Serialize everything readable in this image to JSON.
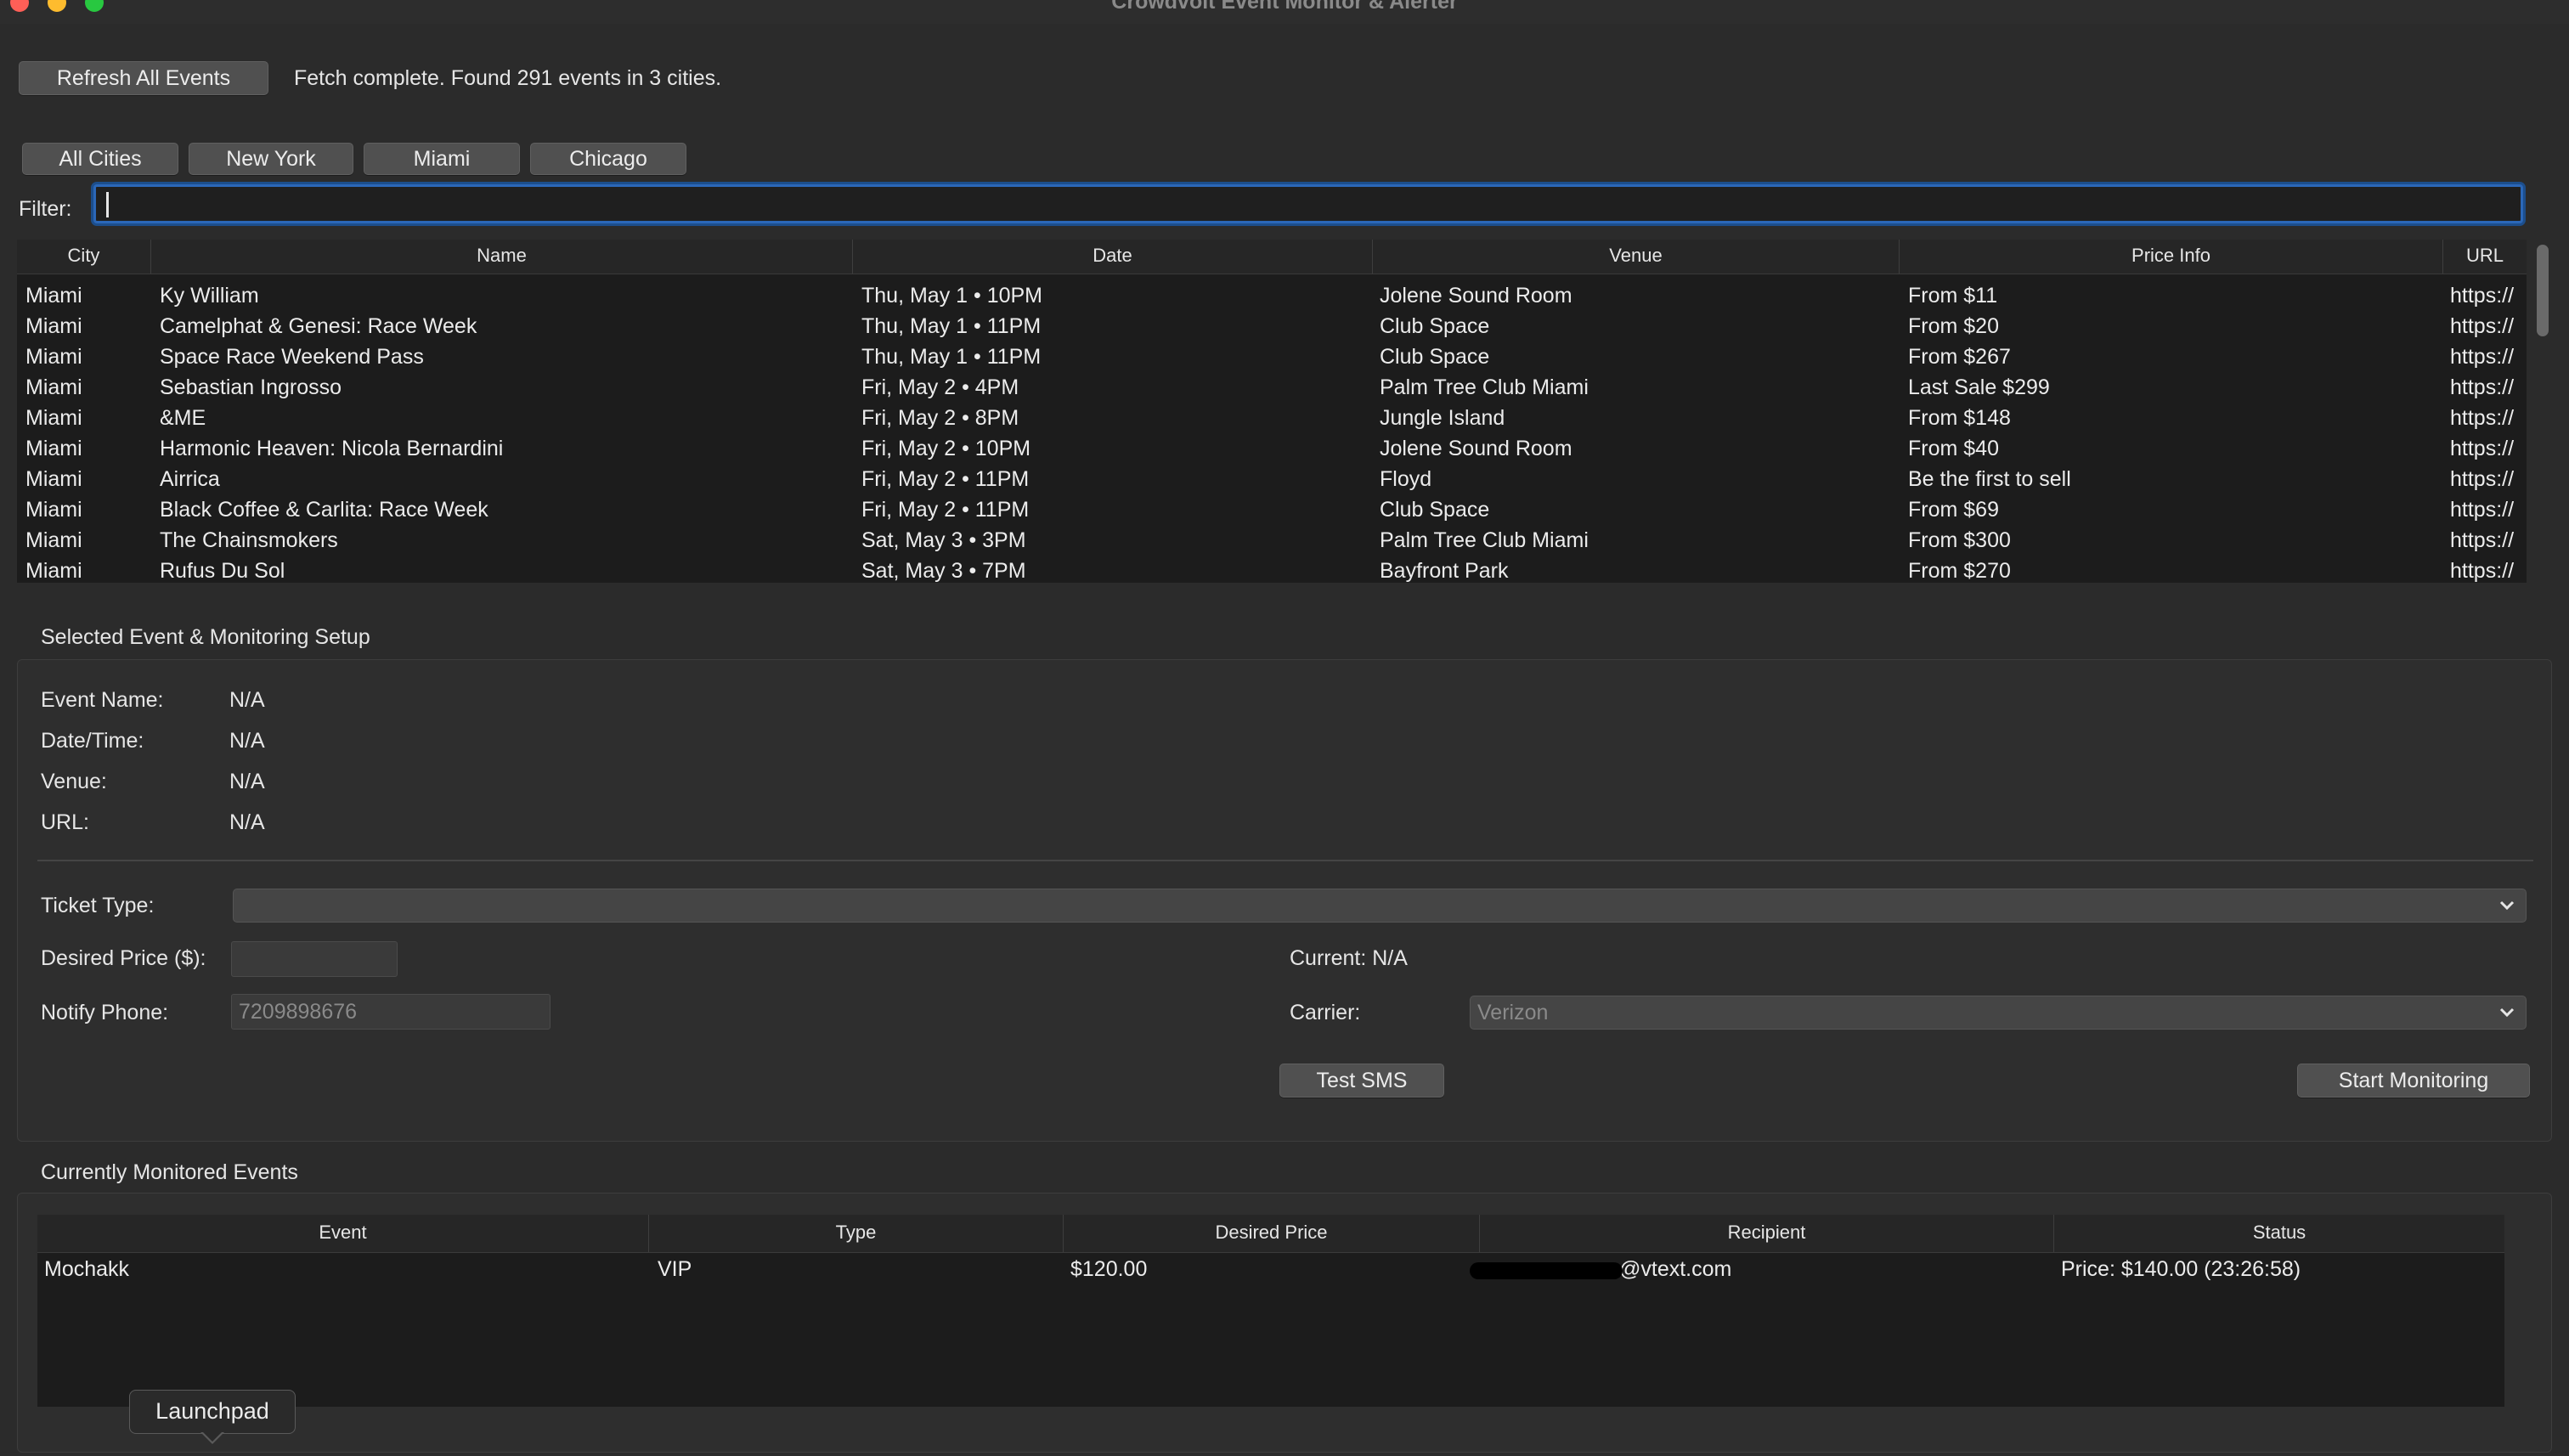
{
  "window": {
    "title": "Crowdvolt Event Monitor & Alerter"
  },
  "toolbar": {
    "refresh_label": "Refresh All Events",
    "status_text": "Fetch complete. Found 291 events in 3 cities."
  },
  "city_tabs": [
    "All Cities",
    "New York",
    "Miami",
    "Chicago"
  ],
  "filter": {
    "label": "Filter:",
    "value": ""
  },
  "events_table": {
    "columns": [
      "City",
      "Name",
      "Date",
      "Venue",
      "Price Info",
      "URL"
    ],
    "rows": [
      [
        "Miami",
        "Ky William",
        "Thu, May 1 • 10PM",
        "Jolene Sound Room",
        "From $11",
        "https://"
      ],
      [
        "Miami",
        "Camelphat & Genesi: Race Week",
        "Thu, May 1 • 11PM",
        "Club Space",
        "From $20",
        "https://"
      ],
      [
        "Miami",
        "Space Race Weekend Pass",
        "Thu, May 1 • 11PM",
        "Club Space",
        "From $267",
        "https://"
      ],
      [
        "Miami",
        "Sebastian Ingrosso",
        "Fri, May 2 • 4PM",
        "Palm Tree Club Miami",
        "Last Sale $299",
        "https://"
      ],
      [
        "Miami",
        "&ME",
        "Fri, May 2 • 8PM",
        "Jungle Island",
        "From $148",
        "https://"
      ],
      [
        "Miami",
        "Harmonic Heaven: Nicola Bernardini",
        "Fri, May 2 • 10PM",
        "Jolene Sound Room",
        "From $40",
        "https://"
      ],
      [
        "Miami",
        "Airrica",
        "Fri, May 2 • 11PM",
        "Floyd",
        "Be the first to sell",
        "https://"
      ],
      [
        "Miami",
        "Black Coffee & Carlita: Race Week",
        "Fri, May 2 • 11PM",
        "Club Space",
        "From $69",
        "https://"
      ],
      [
        "Miami",
        "The Chainsmokers",
        "Sat, May 3 • 3PM",
        "Palm Tree Club Miami",
        "From $300",
        "https://"
      ],
      [
        "Miami",
        "Rufus Du Sol",
        "Sat, May 3 • 7PM",
        "Bayfront Park",
        "From $270",
        "https://"
      ]
    ]
  },
  "selected_event": {
    "section_title": "Selected Event & Monitoring Setup",
    "event_name_label": "Event Name:",
    "event_name_value": "N/A",
    "datetime_label": "Date/Time:",
    "datetime_value": "N/A",
    "venue_label": "Venue:",
    "venue_value": "N/A",
    "url_label": "URL:",
    "url_value": "N/A",
    "ticket_type_label": "Ticket Type:",
    "ticket_type_value": "",
    "desired_price_label": "Desired Price ($):",
    "desired_price_value": "",
    "current_label": "Current: N/A",
    "notify_phone_label": "Notify Phone:",
    "notify_phone_placeholder": "7209898676",
    "carrier_label": "Carrier:",
    "carrier_value": "Verizon",
    "test_sms_label": "Test SMS",
    "start_monitoring_label": "Start Monitoring"
  },
  "monitored": {
    "section_title": "Currently Monitored Events",
    "columns": [
      "Event",
      "Type",
      "Desired Price",
      "Recipient",
      "Status"
    ],
    "rows": [
      [
        "Mochakk",
        "VIP",
        "$120.00",
        "@vtext.com",
        "Price: $140.00 (23:26:58)"
      ]
    ]
  },
  "tooltip": {
    "text": "Launchpad"
  },
  "icons": {
    "combo_arrow": "chevron-down-icon"
  },
  "colors": {
    "accent": "#2b67b8",
    "background": "#2b2b2b",
    "table_background": "#1c1c1c"
  }
}
